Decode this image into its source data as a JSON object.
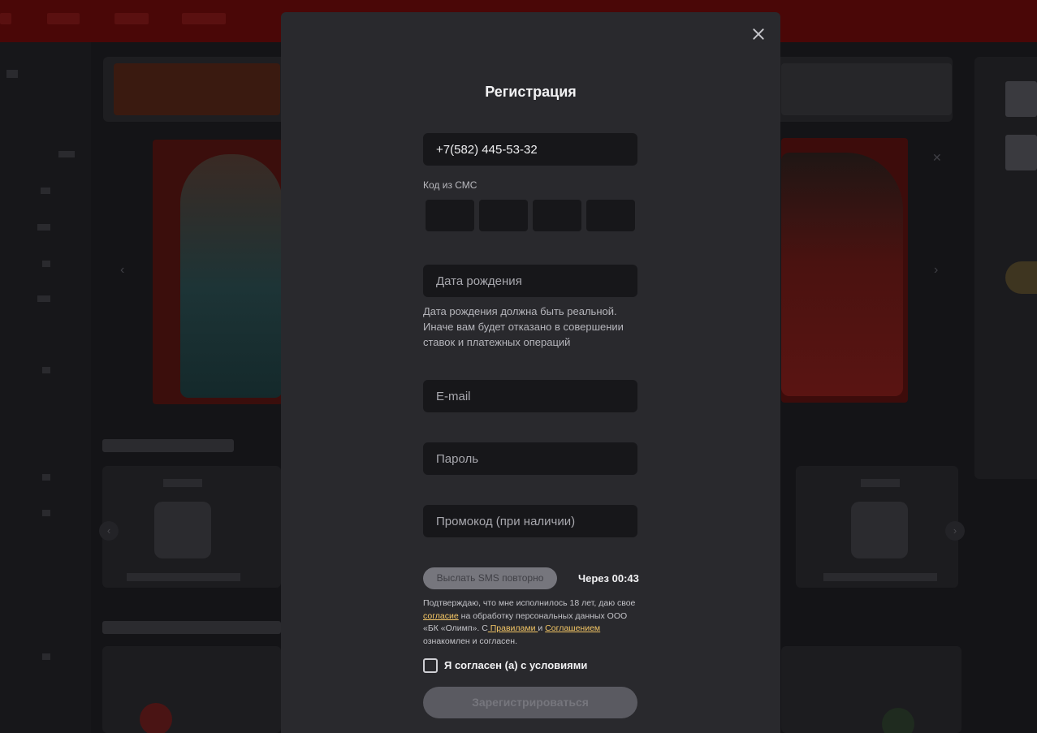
{
  "modal": {
    "title": "Регистрация",
    "phone_value": "+7(582) 445-53-32",
    "sms_code_label": "Код из СМС",
    "dob_placeholder": "Дата рождения",
    "dob_hint": "Дата рождения должна быть реальной. Иначе вам будет отказано в совершении ставок и платежных операций",
    "email_placeholder": "E-mail",
    "password_placeholder": "Пароль",
    "promo_placeholder": "Промокод (при наличии)",
    "resend_sms_label": "Выслать SMS повторно",
    "timer_text": "Через 00:43",
    "consent": {
      "part1": "Подтверждаю, что мне исполнилось 18 лет, даю свое ",
      "link_consent": "согласие",
      "part2": " на обработку персональных данных ООО «БК «Олимп». С",
      "link_rules": " Правилами ",
      "part3": "и ",
      "link_agreement": "Соглашением ",
      "part4": "ознакомлен и согласен."
    },
    "agree_checkbox_label": "Я согласен (а) с условиями",
    "submit_label": "Зарегистрироваться"
  },
  "colors": {
    "modal_bg": "#29292d",
    "input_bg": "#17171a",
    "link_accent": "#f5c766",
    "background_topbar": "#4a0707"
  },
  "icons": {
    "close": "close-icon",
    "carousel_prev": "chevron-left-icon",
    "carousel_next": "chevron-right-icon"
  }
}
